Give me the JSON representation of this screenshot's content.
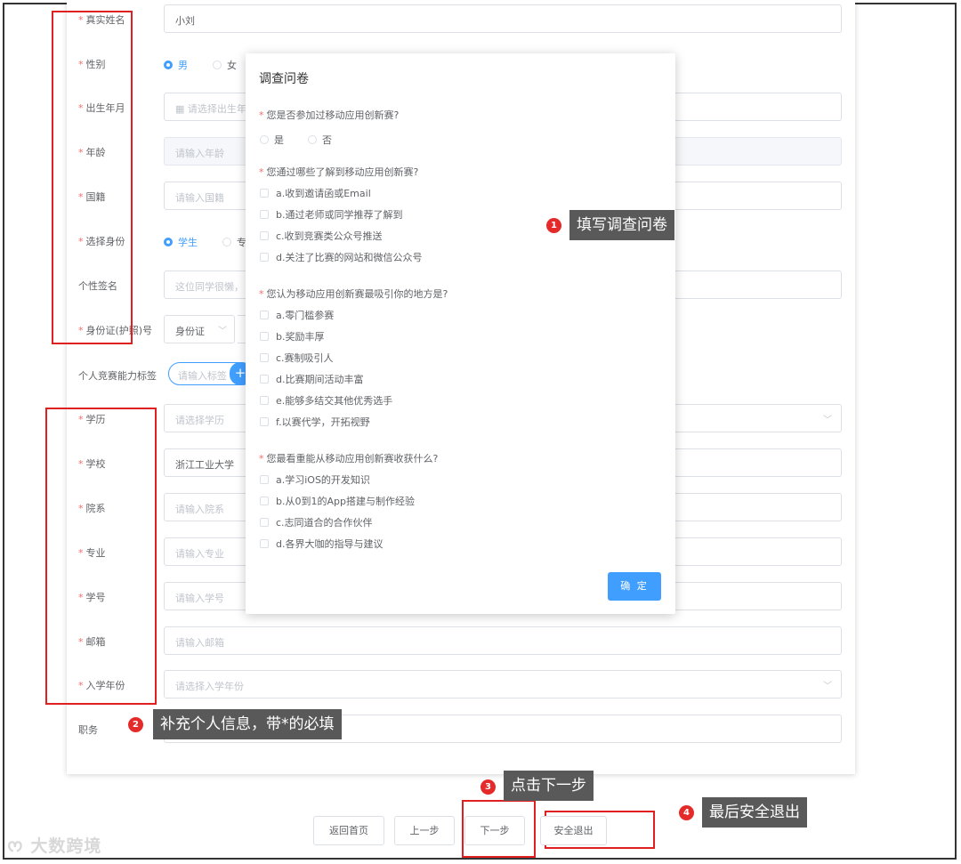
{
  "form": {
    "real_name_label": "真实姓名",
    "real_name_value": "小刘",
    "gender_label": "性别",
    "gender_male": "男",
    "gender_female": "女",
    "birth_label": "出生年月",
    "birth_placeholder": "请选择出生年",
    "age_label": "年龄",
    "age_placeholder": "请输入年龄",
    "nation_label": "国籍",
    "nation_placeholder": "请输入国籍",
    "identity_label": "选择身份",
    "identity_student": "学生",
    "identity_other": "专",
    "signature_label": "个性签名",
    "signature_placeholder": "这位同学很懒，",
    "id_label": "身份证(护照)号",
    "id_type_value": "身份证",
    "skill_tag_label": "个人竞赛能力标签",
    "skill_tag_placeholder": "请输入标签",
    "skill_tag_add": "+",
    "education_label": "学历",
    "education_placeholder": "请选择学历",
    "school_label": "学校",
    "school_value": "浙江工业大学",
    "department_label": "院系",
    "department_placeholder": "请输入院系",
    "major_label": "专业",
    "major_placeholder": "请输入专业",
    "student_id_label": "学号",
    "student_id_placeholder": "请输入学号",
    "email_label": "邮箱",
    "email_placeholder": "请输入邮箱",
    "enroll_year_label": "入学年份",
    "enroll_year_placeholder": "请选择入学年份",
    "position_label": "职务"
  },
  "survey": {
    "title": "调查问卷",
    "q1": "您是否参加过移动应用创新赛?",
    "q1_options": [
      "是",
      "否"
    ],
    "q2": "您通过哪些了解到移动应用创新赛?",
    "q2_options": [
      "a.收到邀请函或Email",
      "b.通过老师或同学推荐了解到",
      "c.收到竞赛类公众号推送",
      "d.关注了比赛的网站和微信公众号"
    ],
    "q3": "您认为移动应用创新赛最吸引你的地方是?",
    "q3_options": [
      "a.零门槛参赛",
      "b.奖励丰厚",
      "c.赛制吸引人",
      "d.比赛期间活动丰富",
      "e.能够多结交其他优秀选手",
      "f.以赛代学，开拓视野"
    ],
    "q4": "您最看重能从移动应用创新赛收获什么?",
    "q4_options": [
      "a.学习iOS的开发知识",
      "b.从0到1的App搭建与制作经验",
      "c.志同道合的合作伙伴",
      "d.各界大咖的指导与建议"
    ],
    "confirm": "确 定"
  },
  "callouts": [
    {
      "num": "1",
      "text": "填写调查问卷"
    },
    {
      "num": "2",
      "text": "补充个人信息，带*的必填"
    },
    {
      "num": "3",
      "text": "点击下一步"
    },
    {
      "num": "4",
      "text": "最后安全退出"
    }
  ],
  "footer": {
    "home": "返回首页",
    "prev": "上一步",
    "next": "下一步",
    "logout": "安全退出"
  },
  "watermark": "大数跨境",
  "colors": {
    "primary": "#409eff",
    "required": "#f56c6c",
    "annotation_red": "#e02020",
    "tooltip_bg": "#595959"
  }
}
